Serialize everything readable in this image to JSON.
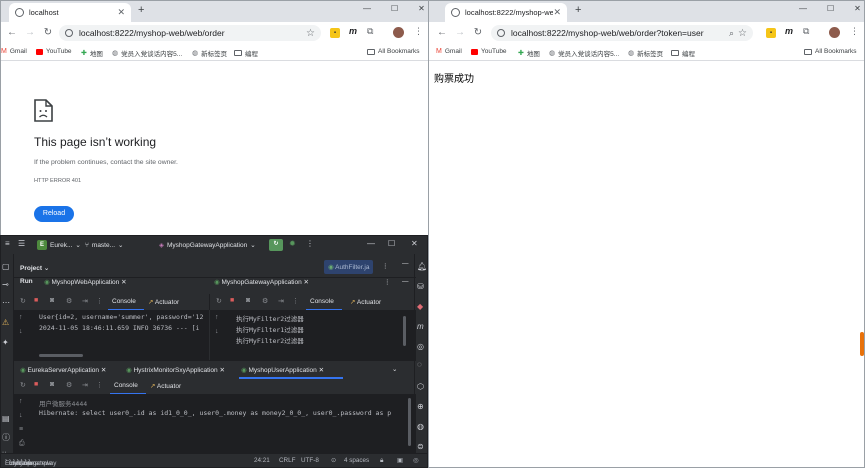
{
  "left_browser": {
    "tab_title": "localhost",
    "url": "localhost:8222/myshop-web/web/order",
    "bookmarks": [
      "Gmail",
      "YouTube",
      "地图",
      "党员入党谈话内容5...",
      "新标签页",
      "编程"
    ],
    "all_bookmarks": "All Bookmarks",
    "error": {
      "heading": "This page isn’t working",
      "message": "If the problem continues, contact the site owner.",
      "code": "HTTP ERROR 401",
      "reload_label": "Reload"
    }
  },
  "right_browser": {
    "tab_title": "localhost:8222/myshop-web/",
    "url": "localhost:8222/myshop-web/web/order?token=user",
    "bookmarks": [
      "Gmail",
      "YouTube",
      "地图",
      "党员入党谈话内容5...",
      "新标签页",
      "编程"
    ],
    "all_bookmarks": "All Bookmarks",
    "body_text": "购票成功"
  },
  "ide": {
    "project_badge": "E",
    "project": "Eurek...",
    "branch": "maste...",
    "run_config": "MyshopGatewayApplication",
    "project_label": "Project",
    "editor_tab": "AuthFilter.ja",
    "run_label": "Run",
    "panel1": {
      "tab": "MyshopWebApplication",
      "console_label": "Console",
      "actuator_label": "Actuator",
      "lines": [
        "User{id=2, username='summer', password='12",
        "2024-11-05 18:46:11.659  INFO 36736 --- [i"
      ]
    },
    "panel2": {
      "tab": "MyshopGatewayApplication",
      "console_label": "Console",
      "actuator_label": "Actuator",
      "lines": [
        "执行MyFilter2过滤器",
        "执行MyFilter1过滤器",
        "执行MyFilter2过滤器"
      ]
    },
    "bottom_tabs": [
      "EurekaServerApplication",
      "HystrixMonitorSxyApplication",
      "MyshopUserApplication"
    ],
    "panel3": {
      "console_label": "Console",
      "actuator_label": "Actuator",
      "lines": [
        "用户微服务4444",
        "Hibernate: select user0_.id as id1_0_0_, user0_.money as money2_0_0_, user0_.password as p"
      ]
    },
    "status": {
      "breadcrumb": [
        "Eureka",
        "myshop-gateway",
        "src",
        "main",
        "java",
        "com",
        "example"
      ],
      "position": "24:21",
      "line_sep": "CRLF",
      "encoding": "UTF-8",
      "indent": "4 spaces"
    }
  },
  "colors": {
    "reload_blue": "#1a73e8",
    "ide_bg": "#2b2d30",
    "console_bg": "#1e1f22",
    "run_green": "#57965c",
    "tab_underline": "#3574f0"
  }
}
